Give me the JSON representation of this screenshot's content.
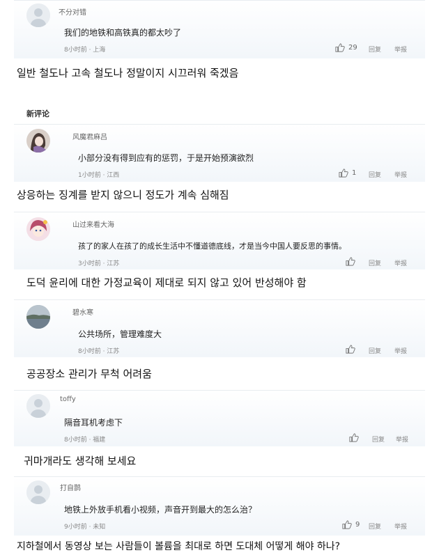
{
  "top_comment": {
    "username": "不分对错",
    "text": "我们的地铁和高铁真的都太吵了",
    "meta": "8小时前 · 上海",
    "likes": "29",
    "reply": "回复",
    "report": "举报",
    "translation": "일반 철도나 고속 철도나 정말이지 시끄러워 죽겠음"
  },
  "section_title": "新评论",
  "comments": [
    {
      "username": "风魔君麻吕",
      "text": "小部分没有得到应有的惩罚，于是开始预演欲烈",
      "meta": "1小时前 · 江西",
      "likes": "1",
      "reply": "回复",
      "report": "举报",
      "translation": "상응하는 징계를 받지 않으니 정도가 계속 심해짐"
    },
    {
      "username": "山过来看大海",
      "text": "孩了的家人在孩了的成长生活中不懂道德底线，才是当今中国人要反思的事情。",
      "meta": "3小时前 · 江苏",
      "likes": "",
      "reply": "回复",
      "report": "举报",
      "translation": "도덕 윤리에 대한 가정교육이 제대로 되지 않고 있어 반성해야 함"
    },
    {
      "username": "碧水寒",
      "text": "公共场所，管理难度大",
      "meta": "8小时前 · 江苏",
      "likes": "",
      "reply": "回复",
      "report": "举报",
      "translation": "공공장소 관리가 무척 어려움"
    },
    {
      "username": "toffy",
      "text": "隔音耳机考虑下",
      "meta": "8小时前 · 福建",
      "likes": "",
      "reply": "回复",
      "report": "举报",
      "translation": "귀마개라도 생각해 보세요"
    },
    {
      "username": "打自鹊",
      "text": "地铁上外放手机看小视频，声音开到最大的怎么治？",
      "meta": "9小时前 · 未知",
      "likes": "9",
      "reply": "回复",
      "report": "举报",
      "translation": "지하철에서 동영상 보는 사람들이 볼륨을 최대로 하면 도대체 어떻게 해야 하나?"
    }
  ],
  "colors": {
    "card_bg": "#f2f6fa",
    "meta": "#888888",
    "text": "#222222"
  }
}
